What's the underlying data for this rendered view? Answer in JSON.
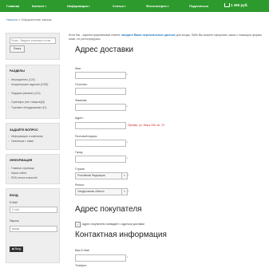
{
  "nav": {
    "items": [
      {
        "label": "Главная",
        "caret": ""
      },
      {
        "label": "Каталог",
        "caret": "▾"
      },
      {
        "label": "Информация",
        "caret": "▾"
      },
      {
        "label": "Статьи",
        "caret": "▾"
      },
      {
        "label": "Фотогалерея",
        "caret": "▾"
      },
      {
        "label": "Поделиться",
        "caret": ""
      }
    ],
    "cart": "1 450 руб."
  },
  "breadcrumb": {
    "home": "Начало",
    "sep": "»",
    "current": "Оформление заказа"
  },
  "search": {
    "placeholder": "Поиск - Введите ключевые слова",
    "button": "Поиск"
  },
  "sections": {
    "title": "РАЗДЕЛЫ",
    "items": [
      "Ингредиенты (120)",
      "Кондитерские изделия (1025)",
      "Подарки (мелкие) (113)",
      "Сувениры (нет товаров)(5)",
      "Торговое оборудование (41)"
    ]
  },
  "ask": {
    "title": "ЗАДАЙТЕ ВОПРОС",
    "items": [
      "Информация о компании",
      "Связаться с нами"
    ]
  },
  "info": {
    "title": "ИНФОРМАЦИЯ",
    "items": [
      "Главная страница",
      "Карта сайта",
      "RSS-лента новостей"
    ]
  },
  "login": {
    "title": "ВХОД",
    "email_label": "E-Mail",
    "email_placeholder": "E-Mail",
    "password_label": "Пароль",
    "password_value": "••••••••",
    "button": "Вход"
  },
  "intro": {
    "before": "Если Вы - зарегистрированный клиент, ",
    "link": "введите Ваши персональные данные",
    "after": " для входа. Либо Вы можете оформить заказ с помощью формы ниже, не регистрируясь."
  },
  "delivery": {
    "heading": "Адрес доставки",
    "fields": [
      "Имя:",
      "Отчество:",
      "Фамилия:",
      "Адрес:",
      "Почтовый индекс:",
      "Город:",
      "Страна:",
      "Регион:"
    ],
    "address_hint": "Пример: ул. Мира 346, кв. 78",
    "country_value": "Российская Федерация",
    "region_value": "Свердловская область"
  },
  "buyer": {
    "heading": "Адрес покупателя",
    "checkbox_label": "Адрес покупателя совпадает с адресом доставки",
    "checkbox_mark": "✓"
  },
  "contact": {
    "heading": "Контактная информация",
    "email_label": "Ваш E-Mail:",
    "phone_label": "Телефон:"
  }
}
